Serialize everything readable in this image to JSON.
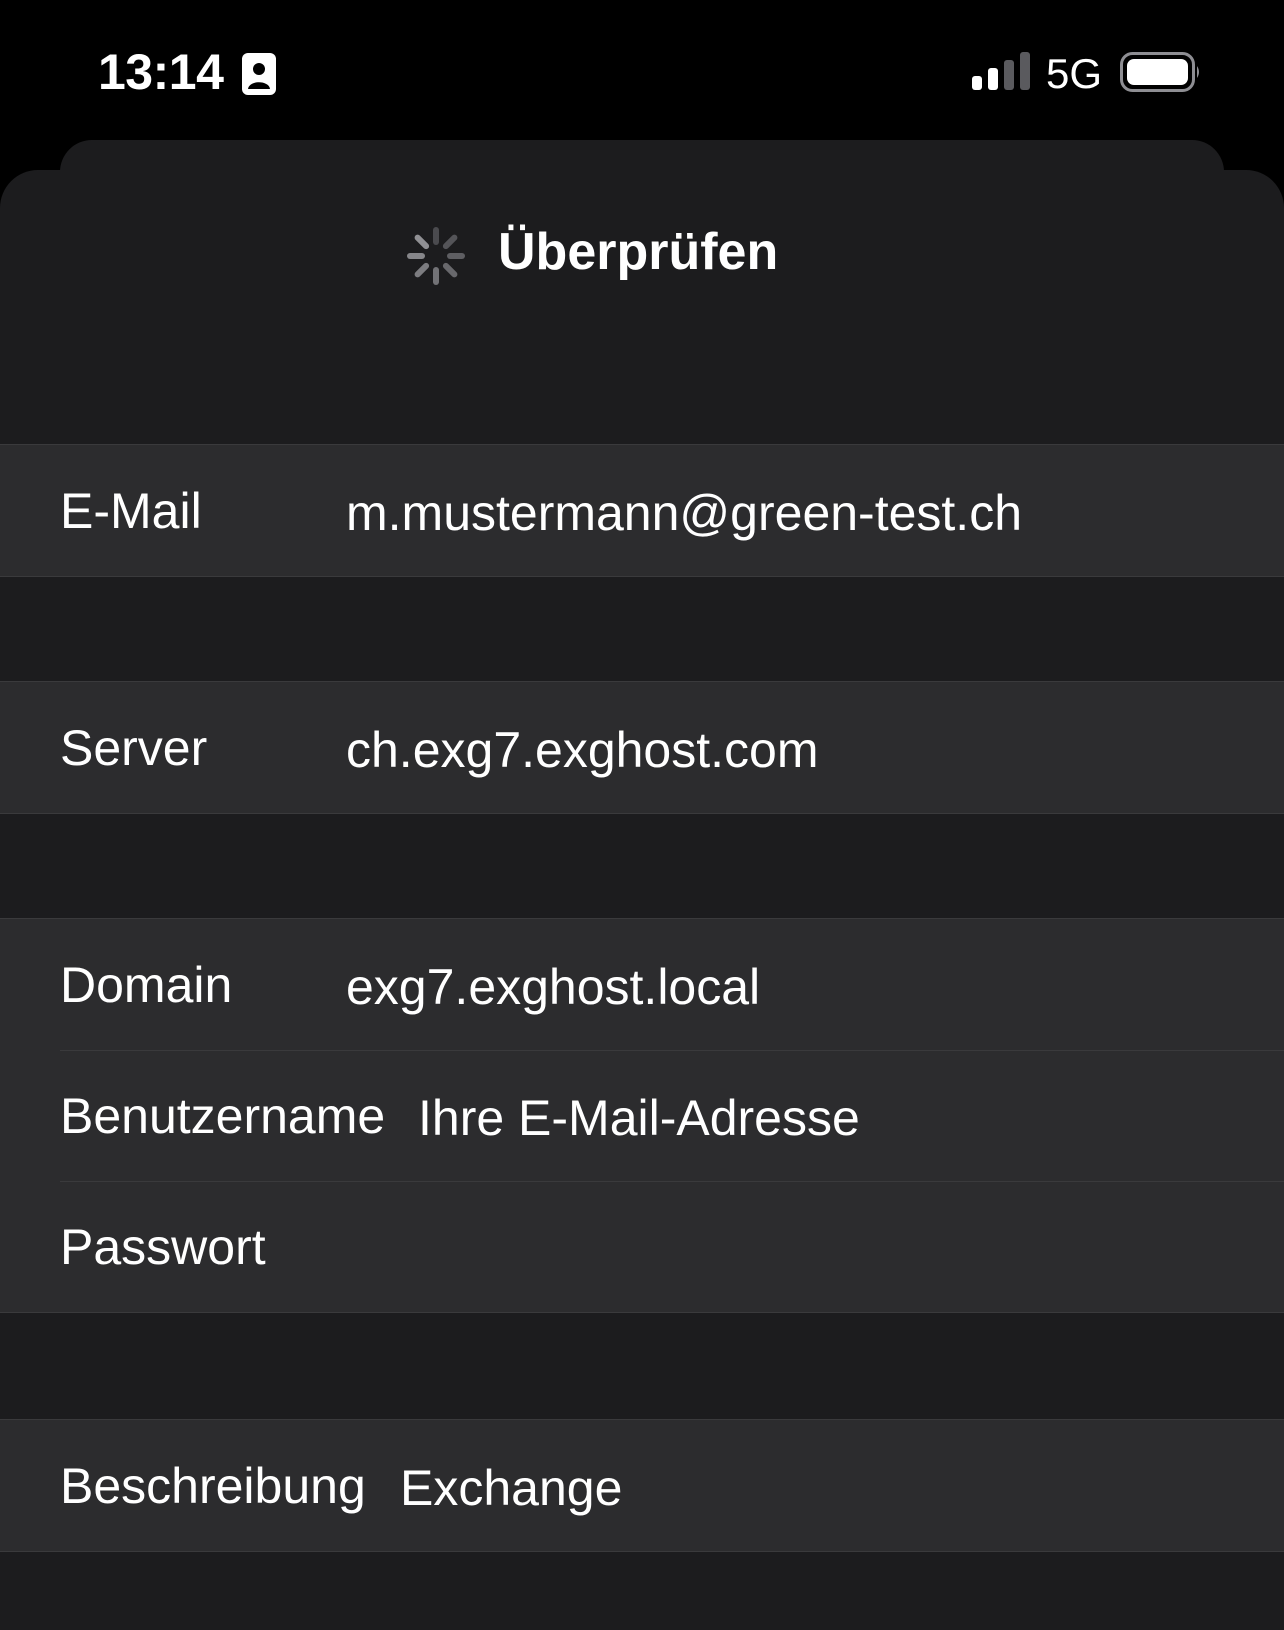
{
  "status_bar": {
    "time": "13:14",
    "network": "5G",
    "signal_bars_active": 2,
    "signal_bars_total": 4,
    "icons": [
      "contact-card-icon",
      "signal-icon",
      "battery-icon"
    ]
  },
  "nav": {
    "title": "Überprüfen",
    "activity_icon": "spinner-icon"
  },
  "form": {
    "email": {
      "label": "E-Mail",
      "value": "m.mustermann@green-test.ch"
    },
    "server": {
      "label": "Server",
      "value": "ch.exg7.exghost.com"
    },
    "domain": {
      "label": "Domain",
      "value": "exg7.exghost.local"
    },
    "username": {
      "label": "Benutzername",
      "value": "Ihre E-Mail-Adresse"
    },
    "password": {
      "label": "Passwort",
      "value": ""
    },
    "description": {
      "label": "Beschreibung",
      "value": "Exchange"
    }
  },
  "colors": {
    "background": "#000000",
    "sheet": "#1c1c1e",
    "cell": "#2c2c2e",
    "separator": "#3a3a3c",
    "text": "#ffffff"
  }
}
